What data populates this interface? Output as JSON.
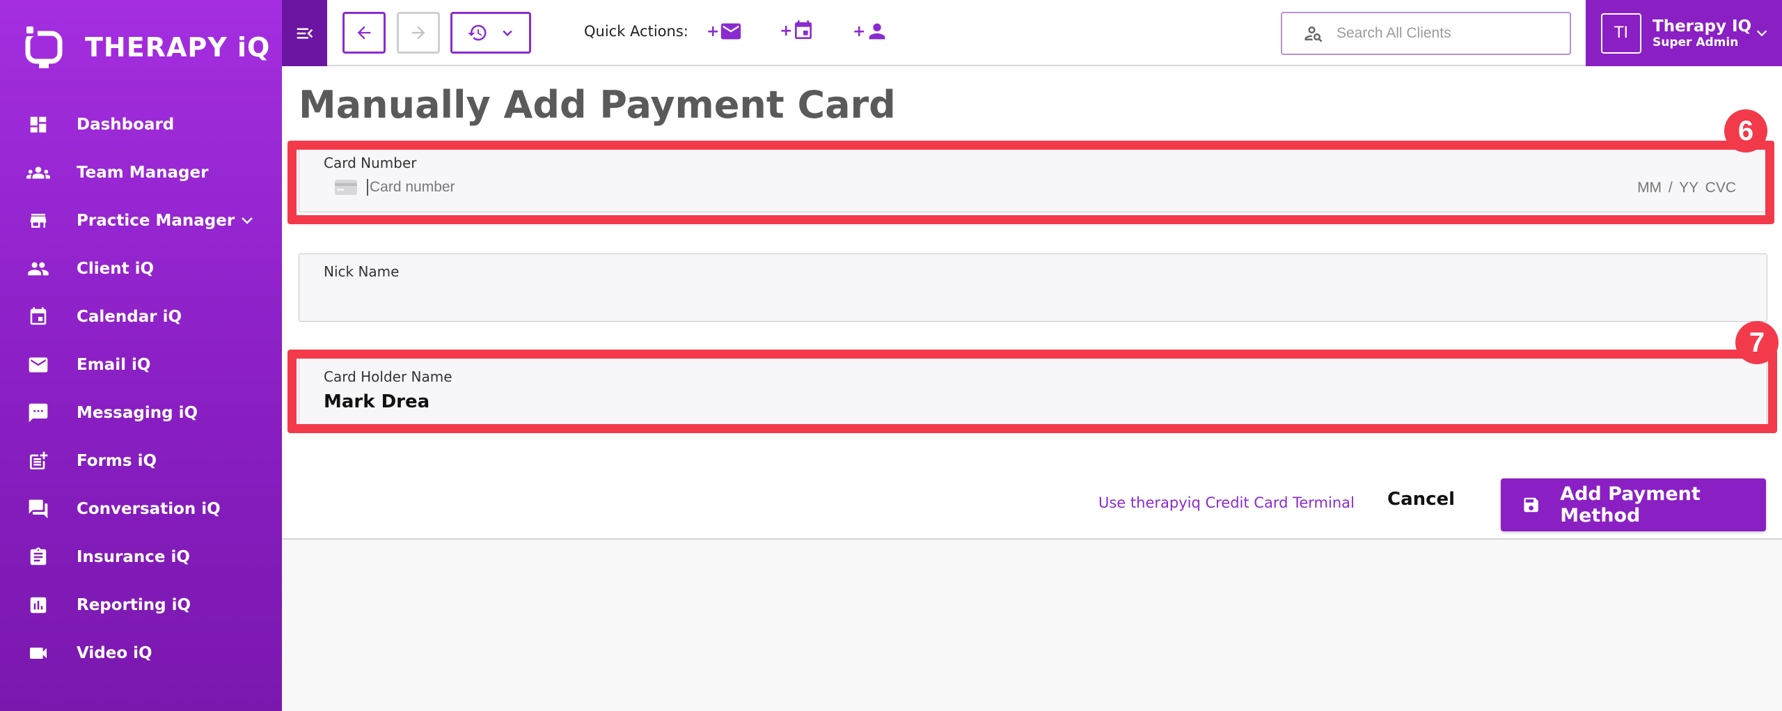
{
  "app": {
    "logo_text": "THERAPY iQ"
  },
  "sidebar": {
    "items": [
      {
        "label": "Dashboard",
        "icon": "dashboard-icon"
      },
      {
        "label": "Team Manager",
        "icon": "team-icon"
      },
      {
        "label": "Practice Manager",
        "icon": "store-icon",
        "expandable": true
      },
      {
        "label": "Client iQ",
        "icon": "people-icon"
      },
      {
        "label": "Calendar iQ",
        "icon": "calendar-icon"
      },
      {
        "label": "Email iQ",
        "icon": "email-icon"
      },
      {
        "label": "Messaging iQ",
        "icon": "message-icon"
      },
      {
        "label": "Forms iQ",
        "icon": "forms-icon"
      },
      {
        "label": "Conversation iQ",
        "icon": "conversation-icon"
      },
      {
        "label": "Insurance iQ",
        "icon": "clipboard-icon"
      },
      {
        "label": "Reporting iQ",
        "icon": "report-icon"
      },
      {
        "label": "Video iQ",
        "icon": "video-icon"
      }
    ]
  },
  "topbar": {
    "quick_actions_label": "Quick Actions:",
    "quick_actions": [
      {
        "prefix": "+",
        "icon": "email-icon"
      },
      {
        "prefix": "+",
        "icon": "calendar-icon"
      },
      {
        "prefix": "+",
        "icon": "person-icon"
      }
    ],
    "search_placeholder": "Search All Clients",
    "user": {
      "initials": "TI",
      "name": "Therapy IQ",
      "role": "Super Admin"
    }
  },
  "page": {
    "title": "Manually Add Payment Card",
    "card_number": {
      "label": "Card Number",
      "placeholder": "Card number",
      "expiry_placeholder": "MM / YY",
      "cvc_placeholder": "CVC"
    },
    "nick_name": {
      "label": "Nick Name",
      "value": ""
    },
    "card_holder": {
      "label": "Card Holder Name",
      "value": "Mark Drea"
    },
    "terminal_link": "Use therapyiq Credit Card Terminal",
    "cancel_label": "Cancel",
    "add_label": "Add Payment Method"
  },
  "annotations": {
    "step_6": "6",
    "step_7": "7",
    "color": "#f23a4a"
  },
  "colors": {
    "brand": "#8a1fc4",
    "brand_dark": "#6d15a3",
    "highlight": "#f23a4a"
  }
}
